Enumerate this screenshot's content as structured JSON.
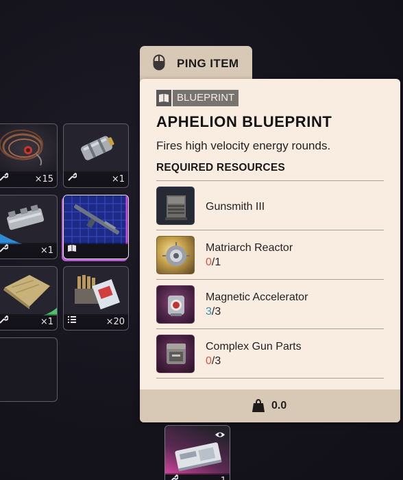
{
  "ping": {
    "label": "PING ITEM"
  },
  "tooltip": {
    "badge": "BLUEPRINT",
    "title": "APHELION BLUEPRINT",
    "description": "Fires high velocity energy rounds.",
    "required_header": "REQUIRED RESOURCES",
    "resources": [
      {
        "name": "Gunsmith III",
        "have": "",
        "sep": "",
        "need": "",
        "icon": "workbench-icon"
      },
      {
        "name": "Matriarch Reactor",
        "have": "0",
        "sep": "/",
        "need": "1",
        "status_color": "#d9553f",
        "icon": "reactor-icon"
      },
      {
        "name": "Magnetic Accelerator",
        "have": "3",
        "sep": "/",
        "need": "3",
        "status_color": "#3d8ab8",
        "icon": "accelerator-icon"
      },
      {
        "name": "Complex Gun Parts",
        "have": "0",
        "sep": "/",
        "need": "3",
        "status_color": "#d9553f",
        "icon": "gun-parts-case-icon"
      }
    ],
    "weight": "0.0"
  },
  "inventory": {
    "slots": [
      {
        "id": "wires",
        "qty": "×15",
        "footer_icon": "wrench-icon"
      },
      {
        "id": "canister",
        "qty": "×1",
        "footer_icon": "wrench-icon"
      },
      {
        "id": "metal-part",
        "qty": "×1",
        "footer_icon": "wrench-icon",
        "accent": "#2f8bd6"
      },
      {
        "id": "aphelion-blueprint",
        "qty": "",
        "footer_icon": "blueprint-book-icon",
        "accent": "#b75bd6"
      },
      {
        "id": "fabric",
        "qty": "×1",
        "footer_icon": "wrench-icon",
        "accent": "#4fc26a"
      },
      {
        "id": "ammo-box",
        "qty": "×20",
        "footer_icon": "list-icon"
      },
      {
        "id": "empty",
        "qty": ""
      },
      {
        "id": "machine-case",
        "qty": "1",
        "footer_icon": "wrench-icon",
        "accent": "#d6469f",
        "marker": "eye-icon"
      }
    ]
  },
  "colors": {
    "card_bg": "#f8ede0",
    "tab_bg": "#d8c9b6",
    "missing": "#d9553f",
    "complete": "#3d8ab8"
  }
}
